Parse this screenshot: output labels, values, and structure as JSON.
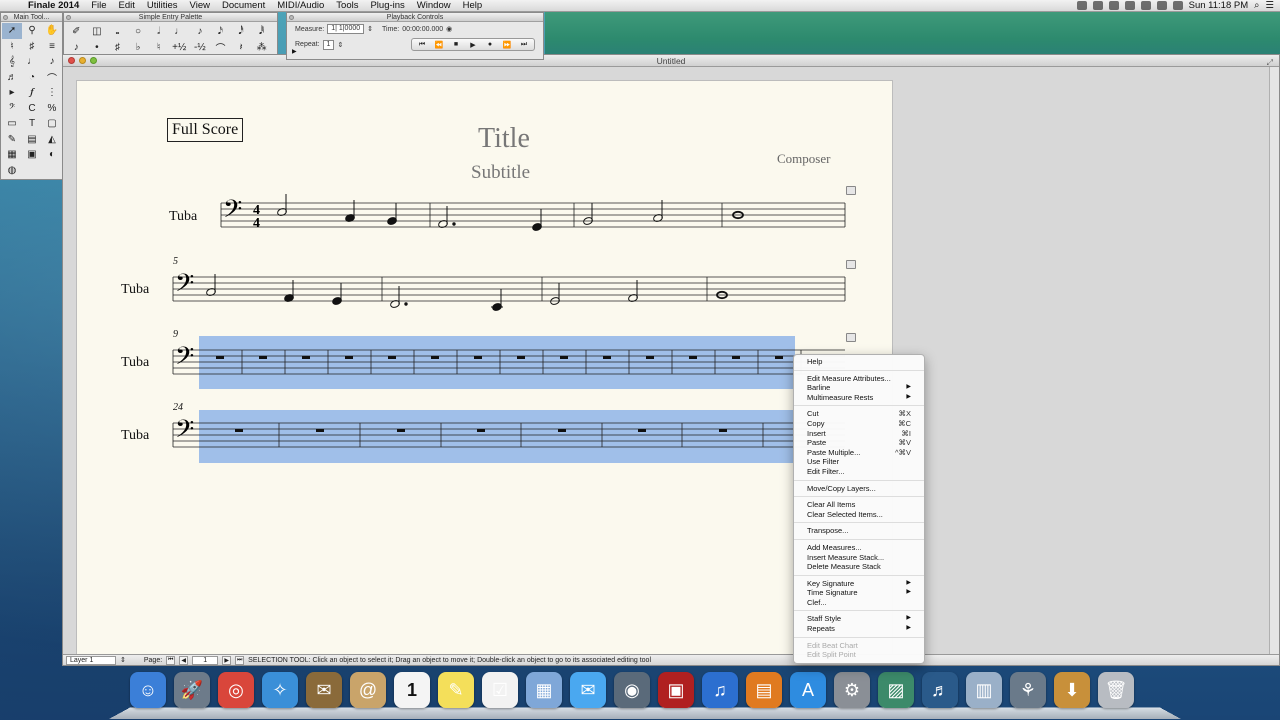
{
  "menubar": {
    "app_name": "Finale 2014",
    "items": [
      "File",
      "Edit",
      "Utilities",
      "View",
      "Document",
      "MIDI/Audio",
      "Tools",
      "Plug-ins",
      "Window",
      "Help"
    ],
    "clock": "Sun 11:18 PM"
  },
  "main_tool_palette": {
    "title": "Main Tool..."
  },
  "simple_entry_palette": {
    "title": "Simple Entry Palette"
  },
  "playback": {
    "title": "Playback Controls",
    "measure_label": "Measure:",
    "measure_value": "1| 1|0000",
    "time_label": "Time:",
    "time_value": "00:00:00.000",
    "repeat_label": "Repeat:",
    "repeat_value": "1"
  },
  "document": {
    "window_title": "Untitled",
    "full_score": "Full Score",
    "title": "Title",
    "subtitle": "Subtitle",
    "composer": "Composer",
    "staff_name": "Tuba",
    "measure_numbers": [
      "5",
      "9",
      "24"
    ]
  },
  "statusbar": {
    "layer": "Layer 1",
    "page_label": "Page:",
    "page_value": "1",
    "message": "SELECTION TOOL: Click an object to select it; Drag an object to move it; Double-click an object to go to its associated editing tool"
  },
  "context_menu": {
    "groups": [
      [
        {
          "label": "Help"
        }
      ],
      [
        {
          "label": "Edit Measure Attributes..."
        },
        {
          "label": "Barline",
          "submenu": true
        },
        {
          "label": "Multimeasure Rests",
          "submenu": true
        }
      ],
      [
        {
          "label": "Cut",
          "shortcut": "⌘X"
        },
        {
          "label": "Copy",
          "shortcut": "⌘C"
        },
        {
          "label": "Insert",
          "shortcut": "⌘I"
        },
        {
          "label": "Paste",
          "shortcut": "⌘V"
        },
        {
          "label": "Paste Multiple...",
          "shortcut": "^⌘V"
        },
        {
          "label": "Use Filter"
        },
        {
          "label": "Edit Filter..."
        }
      ],
      [
        {
          "label": "Move/Copy Layers..."
        }
      ],
      [
        {
          "label": "Clear All Items"
        },
        {
          "label": "Clear Selected Items..."
        }
      ],
      [
        {
          "label": "Transpose..."
        }
      ],
      [
        {
          "label": "Add Measures..."
        },
        {
          "label": "Insert Measure Stack..."
        },
        {
          "label": "Delete Measure Stack"
        }
      ],
      [
        {
          "label": "Key Signature",
          "submenu": true
        },
        {
          "label": "Time Signature",
          "submenu": true
        },
        {
          "label": "Clef..."
        }
      ],
      [
        {
          "label": "Staff Style",
          "submenu": true
        },
        {
          "label": "Repeats",
          "submenu": true
        }
      ],
      [
        {
          "label": "Edit Beat Chart",
          "disabled": true
        },
        {
          "label": "Edit Split Point",
          "disabled": true
        }
      ]
    ]
  },
  "dock": {
    "apps": [
      "finder",
      "launchpad",
      "chrome",
      "safari",
      "mail-stamp",
      "contacts",
      "calendar",
      "stickies",
      "reminders",
      "preview",
      "messages",
      "facetime",
      "photo-booth",
      "itunes",
      "ibooks",
      "app-store",
      "system-preferences",
      "iphoto",
      "finale",
      "preview-2",
      "migration",
      "downloads",
      "trash"
    ],
    "calendar_day": "1"
  }
}
